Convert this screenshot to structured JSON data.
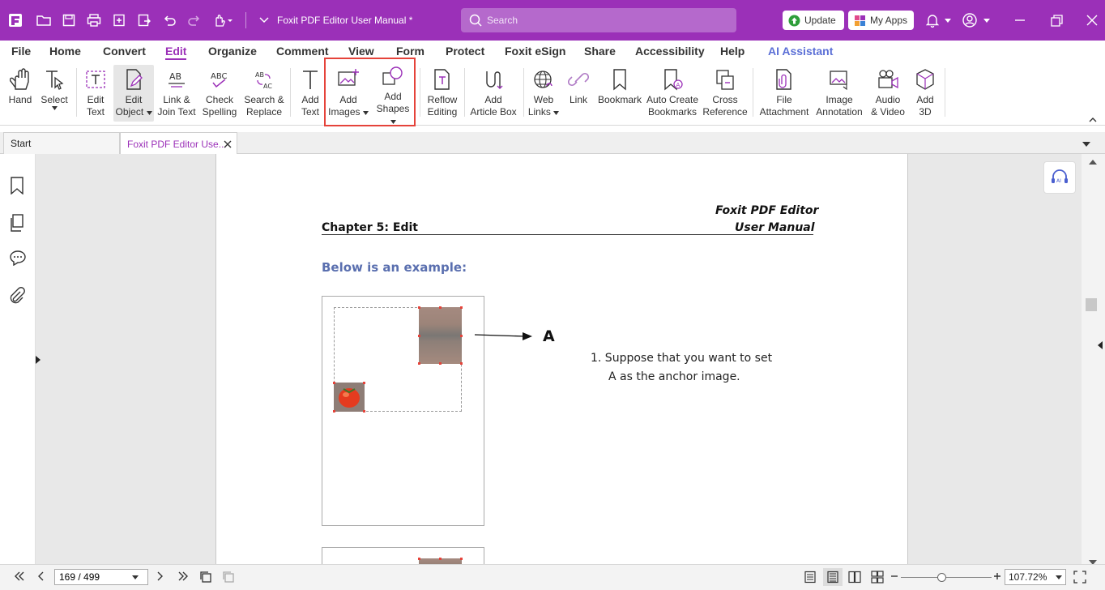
{
  "titlebar": {
    "doc_title": "Foxit PDF Editor User Manual *",
    "search_placeholder": "Search",
    "update_label": "Update",
    "myapps_label": "My Apps",
    "bg": "#9b30b8"
  },
  "menu": {
    "items": [
      "File",
      "Home",
      "Convert",
      "Edit",
      "Organize",
      "Comment",
      "View",
      "Form",
      "Protect",
      "Foxit eSign",
      "Share",
      "Accessibility",
      "Help",
      "AI Assistant"
    ],
    "active": "Edit"
  },
  "ribbon": {
    "hand": "Hand",
    "select": "Select",
    "edit_text_1": "Edit",
    "edit_text_2": "Text",
    "edit_object_1": "Edit",
    "edit_object_2": "Object",
    "link_join_1": "Link &",
    "link_join_2": "Join Text",
    "check_spelling_1": "Check",
    "check_spelling_2": "Spelling",
    "search_replace_1": "Search &",
    "search_replace_2": "Replace",
    "add_text_1": "Add",
    "add_text_2": "Text",
    "add_images_1": "Add",
    "add_images_2": "Images",
    "add_shapes_1": "Add",
    "add_shapes_2": "Shapes",
    "reflow_1": "Reflow",
    "reflow_2": "Editing",
    "article_1": "Add",
    "article_2": "Article Box",
    "web_links_1": "Web",
    "web_links_2": "Links",
    "link": "Link",
    "bookmark": "Bookmark",
    "auto_bm_1": "Auto Create",
    "auto_bm_2": "Bookmarks",
    "cross_1": "Cross",
    "cross_2": "Reference",
    "file_att_1": "File",
    "file_att_2": "Attachment",
    "img_ann_1": "Image",
    "img_ann_2": "Annotation",
    "av_1": "Audio",
    "av_2": "& Video",
    "add3d_1": "Add",
    "add3d_2": "3D"
  },
  "tabs": {
    "start": "Start",
    "doc": "Foxit PDF Editor Use..."
  },
  "pdf": {
    "header_right_1": "Foxit  PDF  Editor",
    "header_right_2": "User Manual",
    "chapter": "Chapter 5: Edit",
    "example_heading": "Below is an example:",
    "label_a": "A",
    "step1_line1": "1. Suppose that you want to set",
    "step1_line2": "A as the anchor image."
  },
  "status": {
    "page": "169 / 499",
    "zoom": "107.72%"
  },
  "zoom_slider_fraction": 0.45
}
